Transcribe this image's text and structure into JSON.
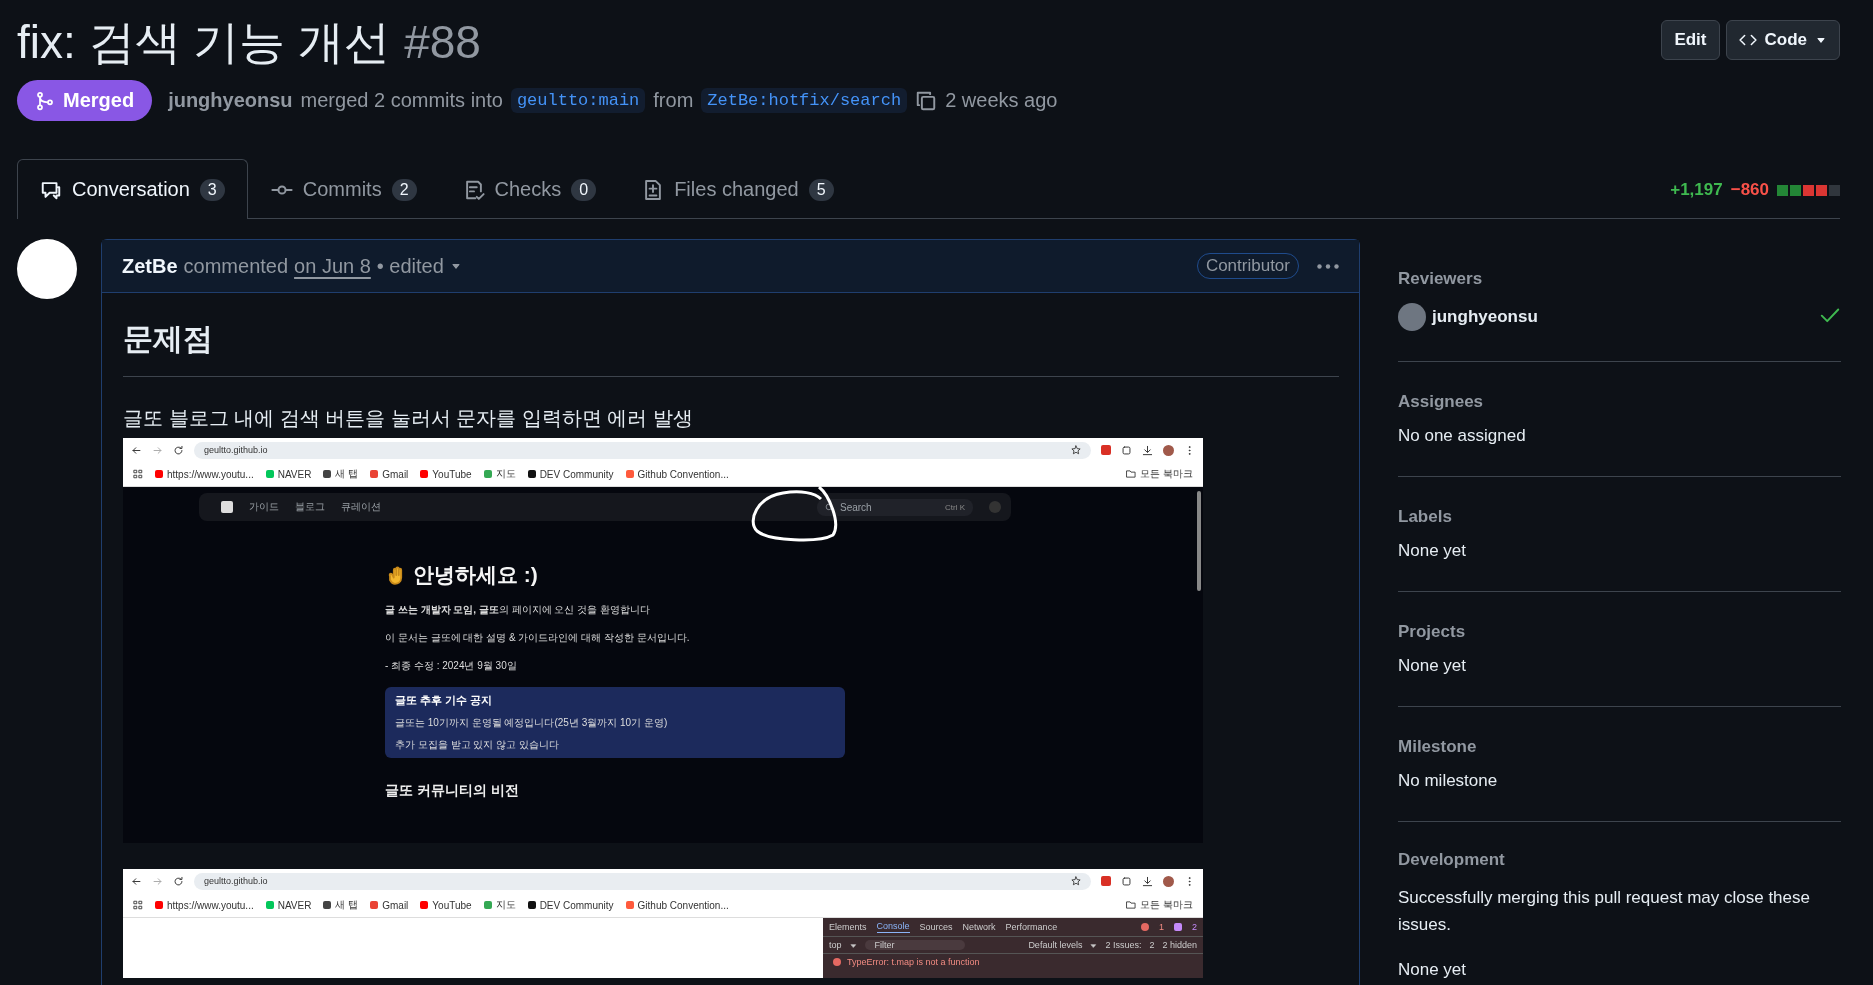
{
  "title": "fix: 검색 기능 개선",
  "number": "#88",
  "actions": [
    {
      "label": "Edit",
      "kind": "plain"
    },
    {
      "label": "Code",
      "kind": "code"
    }
  ],
  "status": {
    "label": "Merged",
    "kind": "merged"
  },
  "summary": {
    "author": "junghyeonsu",
    "text": "merged 2 commits into",
    "base": "geultto:main",
    "from": "from",
    "head": "ZetBe:hotfix/search",
    "time": "2 weeks ago"
  },
  "tabs": [
    {
      "label": "Conversation",
      "count": "3",
      "selected": true,
      "kind": "conversation"
    },
    {
      "label": "Commits",
      "count": "2",
      "selected": false,
      "kind": "commits"
    },
    {
      "label": "Checks",
      "count": "0",
      "selected": false,
      "kind": "checks"
    },
    {
      "label": "Files changed",
      "count": "5",
      "selected": false,
      "kind": "files"
    }
  ],
  "diffstat": {
    "added": "+1,197",
    "removed": "−860",
    "blocks": [
      {
        "color": "#238636"
      },
      {
        "color": "#238636"
      },
      {
        "color": "#da3633"
      },
      {
        "color": "#da3633"
      },
      {
        "color": "#30363d"
      }
    ]
  },
  "comment": {
    "author": "ZetBe",
    "action": "commented",
    "date": "on Jun 8",
    "edited": "• edited",
    "badge": "Contributor",
    "heading": "문제점",
    "text": "글또 블로그 내에 검색 버튼을 눌러서 문자를 입력하면 에러 발생",
    "screenshots": [
      {
        "kind": "site",
        "url": "geultto.github.io",
        "bookmarks": [
          "https://www.youtu...",
          "NAVER",
          "새 탭",
          "Gmail",
          "YouTube",
          "지도",
          "DEV Community",
          "Github Convention..."
        ],
        "all_bookmarks": "모든 북마크",
        "nav": [
          "가이드",
          "블로그",
          "큐레이션"
        ],
        "search": "Search",
        "shortcut": [
          "Ctrl",
          "K"
        ],
        "heading": "안녕하세요 :)",
        "paragraphs": [
          "**글 쓰는 개발자 모임, 글또**의 페이지에 오신 것을 환영합니다",
          "이 문서는 글또에 대한 설명 & 가이드라인에 대해 작성한 문서입니다.",
          "- 최종 수정 : 2024년 9월 30일"
        ],
        "notice": {
          "title": "글또 추후 기수 공지",
          "lines": [
            "글또는 10기까지 운영될 예정입니다(25년 3월까지 10기 운영)",
            "추가 모집을 받고 있지 않고 있습니다"
          ]
        },
        "section": "글또 커뮤니티의 비전"
      },
      {
        "kind": "devtools",
        "url": "geultto.github.io",
        "bookmarks": [
          "https://www.youtu...",
          "NAVER",
          "새 탭",
          "Gmail",
          "YouTube",
          "지도",
          "DEV Community",
          "Github Convention..."
        ],
        "all_bookmarks": "모든 북마크",
        "devtools": {
          "tabs": [
            {
              "label": "Elements",
              "selected": false
            },
            {
              "label": "Console",
              "selected": true
            },
            {
              "label": "Sources",
              "selected": false
            },
            {
              "label": "Network",
              "selected": false
            },
            {
              "label": "Performance",
              "selected": false
            }
          ],
          "errors": "1",
          "warnings": "2",
          "context": "top",
          "filter": "Filter",
          "levels": "Default levels",
          "issues": "2 Issues:",
          "issue_count": "2",
          "hidden": "2 hidden",
          "error": "TypeError: t.map is not a function"
        }
      }
    ]
  },
  "sidebar": {
    "reviewers": {
      "title": "Reviewers",
      "items": [
        {
          "name": "junghyeonsu",
          "approved": true
        }
      ]
    },
    "sections": [
      {
        "title": "Assignees",
        "value": "No one assigned"
      },
      {
        "title": "Labels",
        "value": "None yet"
      },
      {
        "title": "Projects",
        "value": "None yet"
      },
      {
        "title": "Milestone",
        "value": "No milestone"
      }
    ],
    "development": {
      "title": "Development",
      "text": "Successfully merging this pull request may close these issues.",
      "value": "None yet"
    }
  }
}
